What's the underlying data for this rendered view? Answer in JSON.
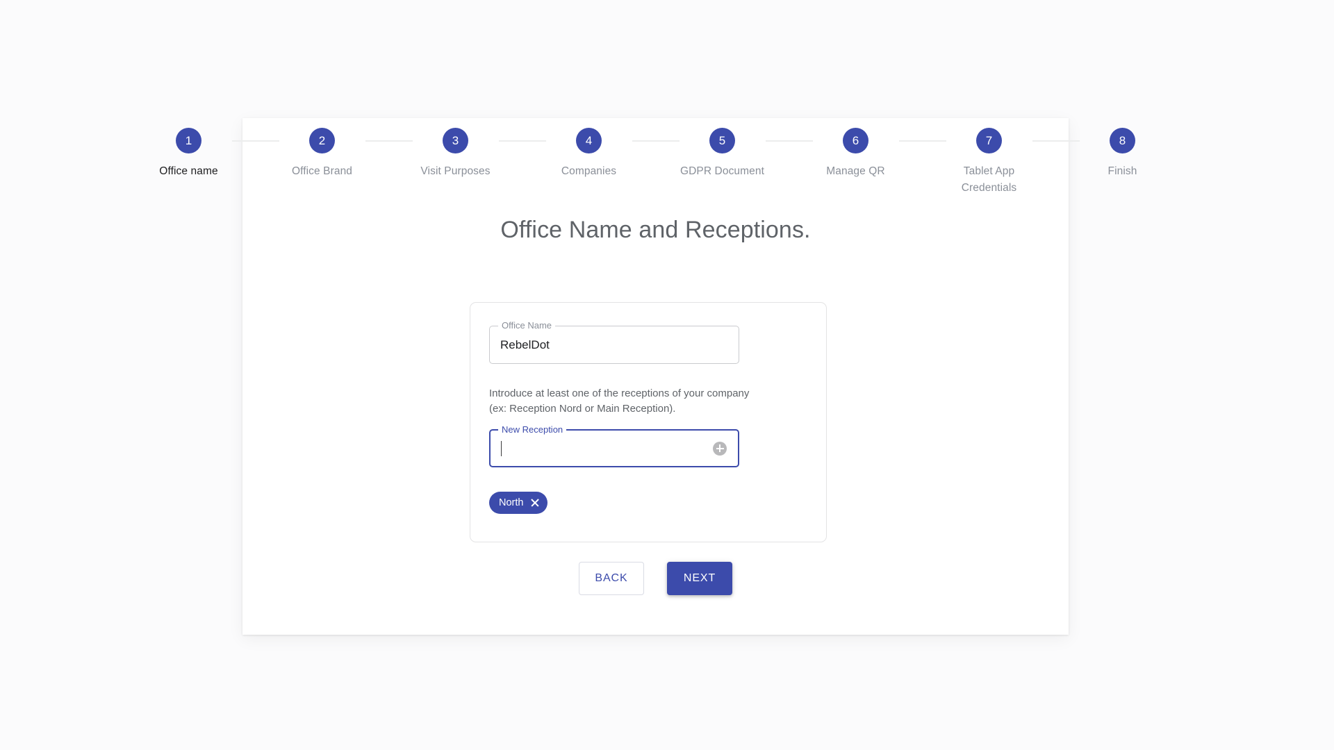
{
  "theme": {
    "accent": "#3c4bab",
    "page_background": "#fbfbfc",
    "card_background": "#ffffff",
    "muted_text": "#8a8f98",
    "title_text": "#5f6368"
  },
  "stepper": {
    "steps": [
      {
        "number": "1",
        "label": "Office name",
        "active": true
      },
      {
        "number": "2",
        "label": "Office Brand",
        "active": false
      },
      {
        "number": "3",
        "label": "Visit Purposes",
        "active": false
      },
      {
        "number": "4",
        "label": "Companies",
        "active": false
      },
      {
        "number": "5",
        "label": "GDPR Document",
        "active": false
      },
      {
        "number": "6",
        "label": "Manage QR",
        "active": false
      },
      {
        "number": "7",
        "label": "Tablet App Credentials",
        "active": false
      },
      {
        "number": "8",
        "label": "Finish",
        "active": false
      }
    ]
  },
  "main": {
    "title": "Office Name and Receptions.",
    "office_name_field": {
      "label": "Office Name",
      "value": "RebelDot"
    },
    "reception_help_text": "Introduce at least one of the receptions of your company (ex: Reception Nord or Main Reception).",
    "new_reception_field": {
      "label": "New Reception",
      "value": "",
      "add_icon": "add-circle-icon"
    },
    "receptions": [
      {
        "name": "North",
        "remove_icon": "close-icon"
      }
    ]
  },
  "actions": {
    "back_label": "BACK",
    "next_label": "NEXT"
  }
}
